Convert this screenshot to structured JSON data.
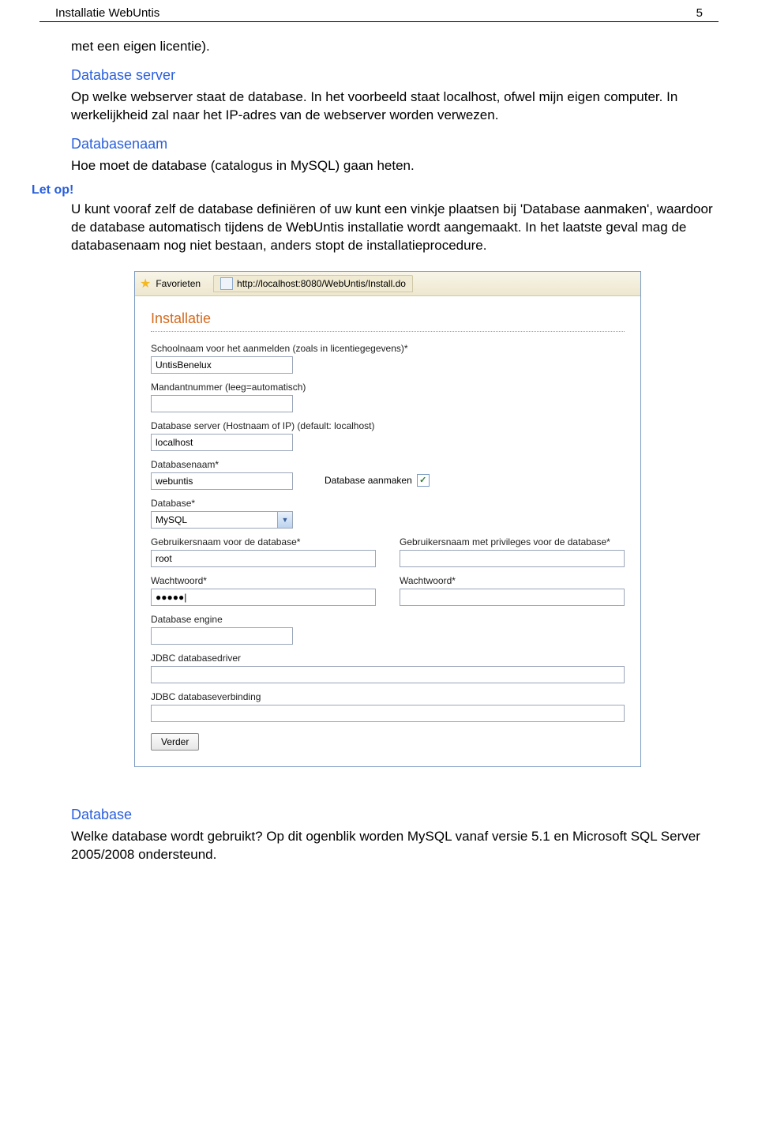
{
  "header": {
    "title": "Installatie WebUntis",
    "page_number": "5"
  },
  "intro_text": "met een eigen licentie).",
  "sections": {
    "db_server_title": "Database server",
    "db_server_text": "Op welke webserver staat de database. In het voorbeeld staat localhost, ofwel mijn eigen computer. In werkelijkheid zal naar het IP-adres van de webserver worden verwezen.",
    "db_name_title": "Databasenaam",
    "db_name_text": "Hoe moet de database (catalogus in MySQL) gaan heten.",
    "letop_label": "Let op!",
    "letop_text": "U kunt vooraf zelf de database definiëren of uw kunt een vinkje plaatsen bij 'Database aanmaken', waardoor de database automatisch tijdens de WebUntis installatie wordt aangemaakt. In het laatste geval mag de databasenaam nog niet bestaan, anders stopt de installatieprocedure.",
    "database_title": "Database",
    "database_text": "Welke database wordt gebruikt? Op dit ogenblik worden MySQL vanaf versie 5.1 en Microsoft SQL Server 2005/2008 ondersteund."
  },
  "screenshot": {
    "fav_label": "Favorieten",
    "url": "http://localhost:8080/WebUntis/Install.do",
    "install_heading": "Installatie",
    "labels": {
      "schoolnaam": "Schoolnaam voor het aanmelden (zoals in licentiegegevens)*",
      "mandant": "Mandantnummer (leeg=automatisch)",
      "dbserver": "Database server (Hostnaam of IP) (default: localhost)",
      "dbname": "Databasenaam*",
      "db_aanmaken": "Database aanmaken",
      "database": "Database*",
      "gebruikersnaam": "Gebruikersnaam voor de database*",
      "gebruikersnaam_priv": "Gebruikersnaam met privileges voor de database*",
      "wachtwoord": "Wachtwoord*",
      "wachtwoord2": "Wachtwoord*",
      "db_engine": "Database engine",
      "jdbc_driver": "JDBC databasedriver",
      "jdbc_verbinding": "JDBC databaseverbinding",
      "verder": "Verder"
    },
    "values": {
      "schoolnaam": "UntisBenelux",
      "mandant": "",
      "dbserver": "localhost",
      "dbname": "webuntis",
      "database": "MySQL",
      "gebruikersnaam": "root",
      "gebruikersnaam_priv": "",
      "wachtwoord": "●●●●●|",
      "wachtwoord2": "",
      "db_engine": "",
      "jdbc_driver": "",
      "jdbc_verbinding": ""
    }
  }
}
